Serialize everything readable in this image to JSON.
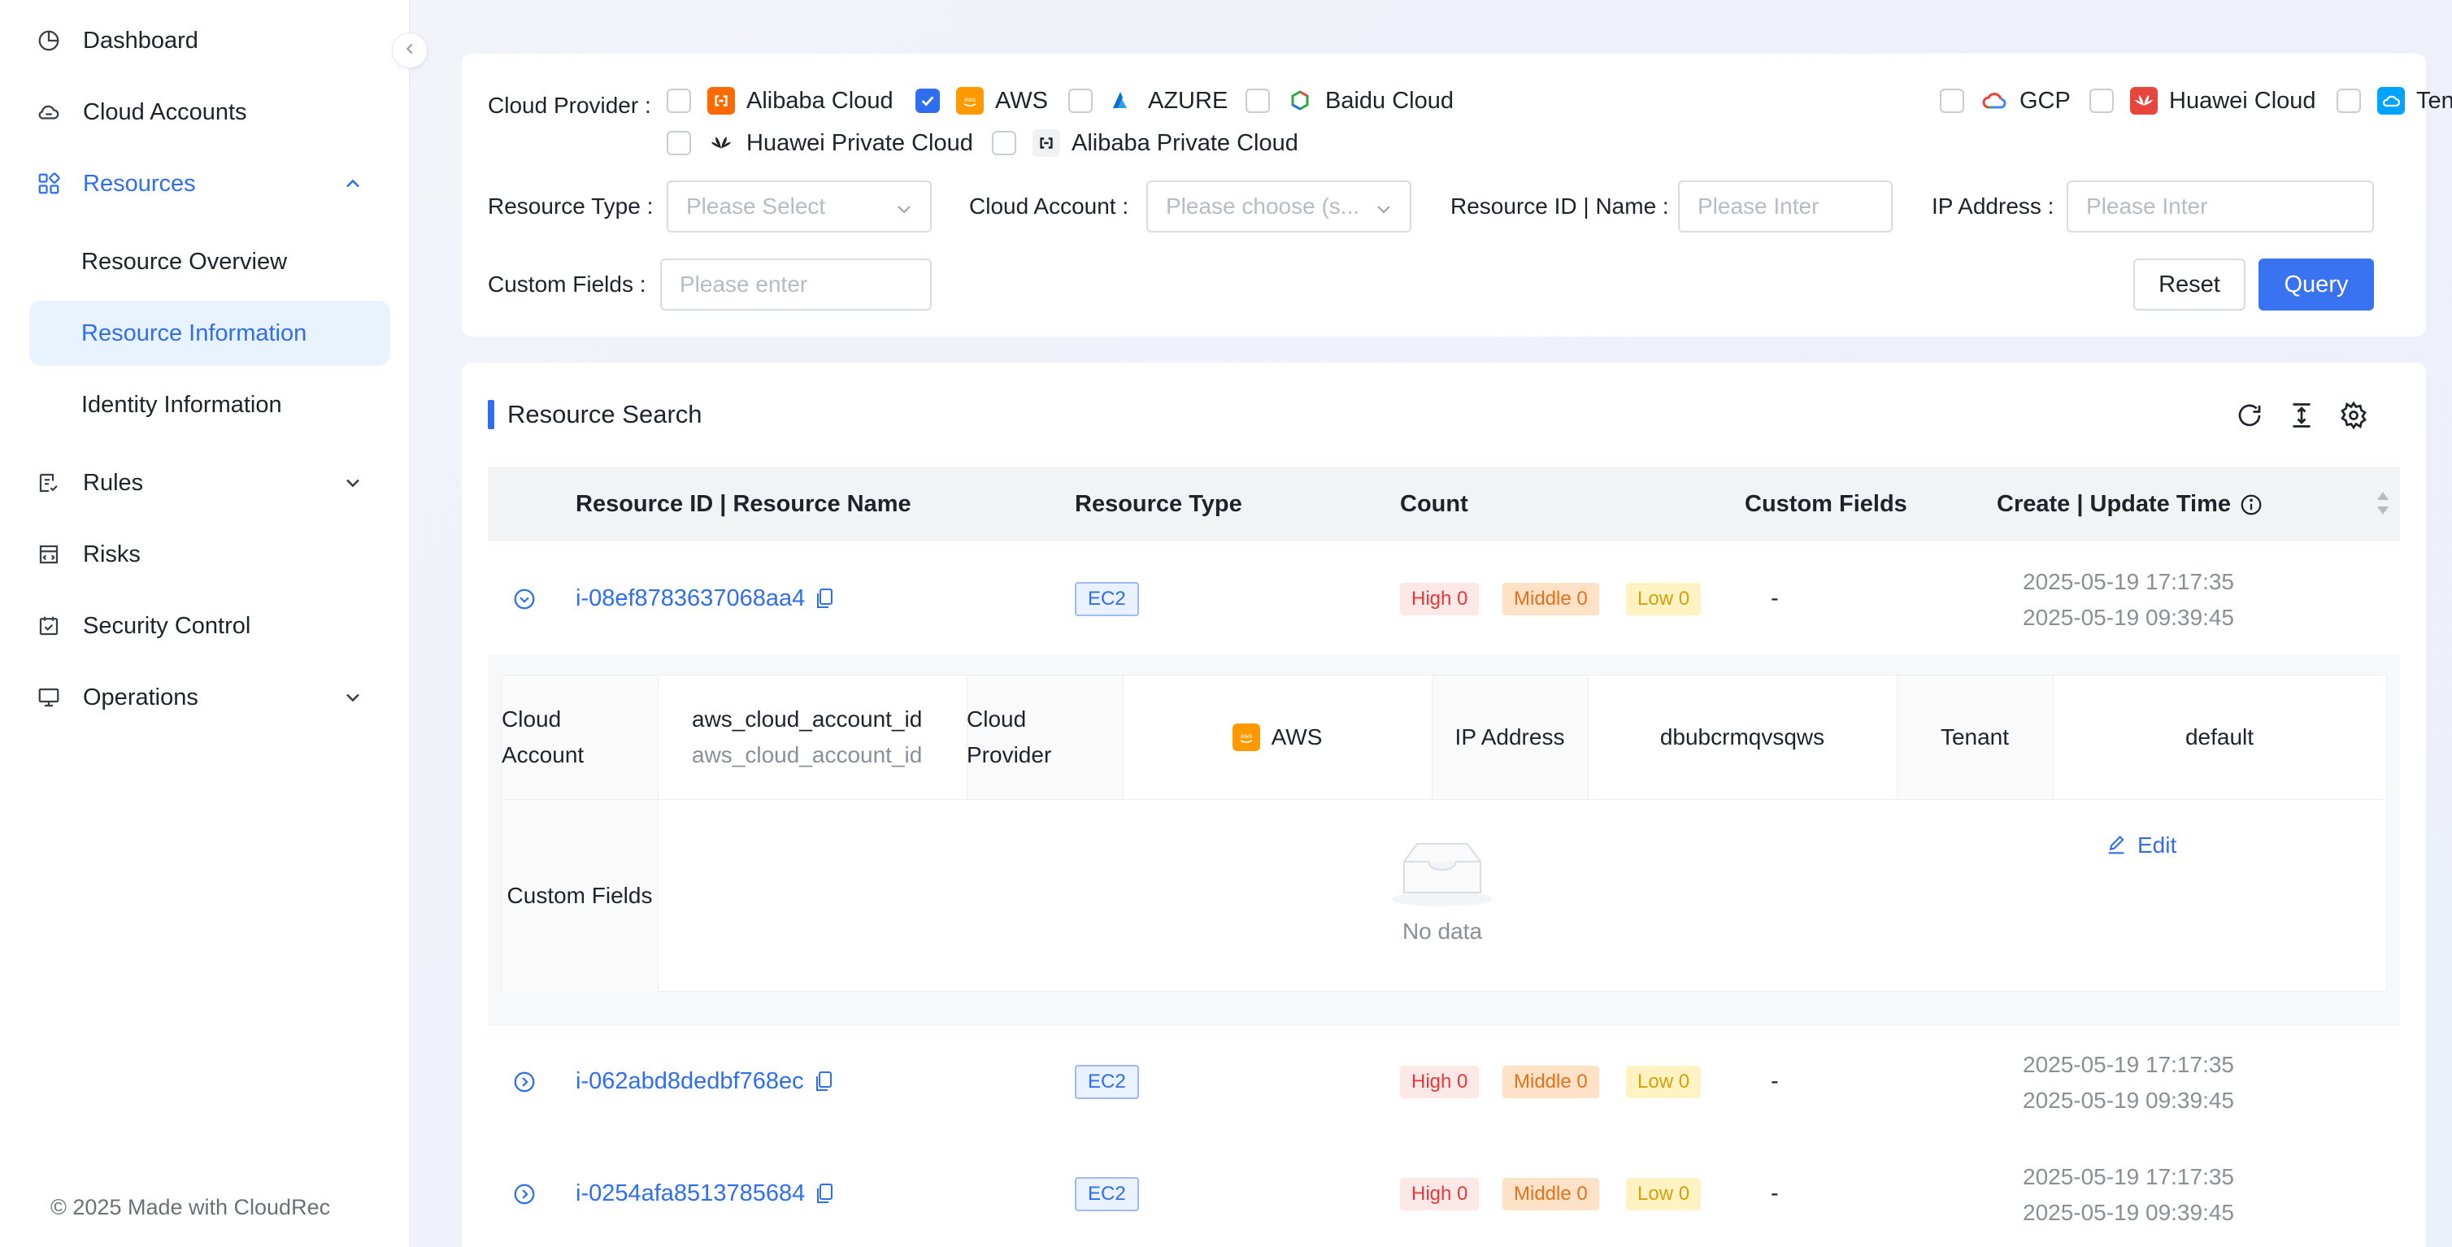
{
  "sidebar": {
    "items": [
      {
        "label": "Dashboard",
        "icon": "pie-chart-icon"
      },
      {
        "label": "Cloud Accounts",
        "icon": "cloud-icon"
      },
      {
        "label": "Resources",
        "icon": "grid-icon",
        "expanded": true
      },
      {
        "label": "Rules",
        "icon": "rules-icon",
        "expanded": false
      },
      {
        "label": "Risks",
        "icon": "risk-icon"
      },
      {
        "label": "Security Control",
        "icon": "calendar-check-icon"
      },
      {
        "label": "Operations",
        "icon": "monitor-icon",
        "expanded": false
      }
    ],
    "subitems": [
      {
        "label": "Resource Overview"
      },
      {
        "label": "Resource Information",
        "selected": true
      },
      {
        "label": "Identity Information"
      }
    ],
    "footer": "© 2025 Made with CloudRec"
  },
  "filters": {
    "cloud_provider_label": "Cloud Provider",
    "providers": [
      {
        "name": "Alibaba Cloud",
        "checked": false,
        "icon": "alibaba-cloud-icon",
        "color": "#ff6a00"
      },
      {
        "name": "AWS",
        "checked": true,
        "icon": "aws-icon",
        "color": "#ff9900"
      },
      {
        "name": "AZURE",
        "checked": false,
        "icon": "azure-icon",
        "color": "#0078d4"
      },
      {
        "name": "Baidu Cloud",
        "checked": false,
        "icon": "baidu-cloud-icon",
        "color": "#2932e1"
      },
      {
        "name": "GCP",
        "checked": false,
        "icon": "gcp-icon",
        "color": "#4285f4"
      },
      {
        "name": "Huawei Cloud",
        "checked": false,
        "icon": "huawei-cloud-icon",
        "color": "#e8453c"
      },
      {
        "name": "Tencent Cloud",
        "checked": false,
        "icon": "tencent-cloud-icon",
        "color": "#00a4ff"
      },
      {
        "name": "Huawei Private Cloud",
        "checked": false,
        "icon": "huawei-private-cloud-icon",
        "color": "#1f2329"
      },
      {
        "name": "Alibaba Private Cloud",
        "checked": false,
        "icon": "alibaba-private-cloud-icon",
        "color": "#1f2329"
      }
    ],
    "resource_type_label": "Resource Type",
    "resource_type_placeholder": "Please Select",
    "cloud_account_label": "Cloud Account",
    "cloud_account_placeholder": "Please choose (s...",
    "resource_id_label": "Resource ID | Name",
    "resource_id_placeholder": "Please Inter",
    "ip_label": "IP Address",
    "ip_placeholder": "Please Inter",
    "custom_fields_label": "Custom Fields",
    "custom_fields_placeholder": "Please enter",
    "reset_label": "Reset",
    "query_label": "Query"
  },
  "results": {
    "title": "Resource Search",
    "columns": {
      "id_name": "Resource ID  |  Resource Name",
      "type": "Resource Type",
      "count": "Count",
      "custom_fields": "Custom Fields",
      "time": "Create | Update Time"
    },
    "rows": [
      {
        "id": "i-08ef8783637068aa4",
        "type": "EC2",
        "high": "High 0",
        "middle": "Middle 0",
        "low": "Low 0",
        "custom": "-",
        "created": "2025-05-19 17:17:35",
        "updated": "2025-05-19 09:39:45",
        "expanded": true
      },
      {
        "id": "i-062abd8dedbf768ec",
        "type": "EC2",
        "high": "High 0",
        "middle": "Middle 0",
        "low": "Low 0",
        "custom": "-",
        "created": "2025-05-19 17:17:35",
        "updated": "2025-05-19 09:39:45",
        "expanded": false
      },
      {
        "id": "i-0254afa8513785684",
        "type": "EC2",
        "high": "High 0",
        "middle": "Middle 0",
        "low": "Low 0",
        "custom": "-",
        "created": "2025-05-19 17:17:35",
        "updated": "2025-05-19 09:39:45",
        "expanded": false
      }
    ],
    "detail": {
      "cloud_account_label_1": "Cloud",
      "cloud_account_label_2": "Account",
      "cloud_account_value": "aws_cloud_account_id",
      "cloud_account_sub": "aws_cloud_account_id",
      "cloud_provider_label_1": "Cloud",
      "cloud_provider_label_2": "Provider",
      "cloud_provider_value": "AWS",
      "ip_label": "IP Address",
      "ip_value": "dbubcrmqvsqws",
      "tenant_label": "Tenant",
      "tenant_value": "default",
      "custom_fields_label": "Custom Fields",
      "edit_label": "Edit",
      "no_data": "No data"
    }
  }
}
